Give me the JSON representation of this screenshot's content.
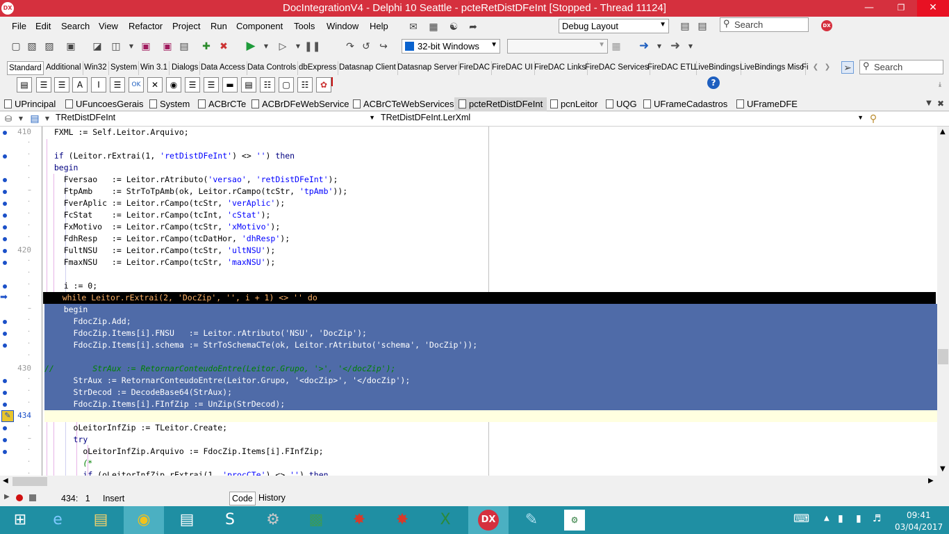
{
  "window": {
    "title": "DocIntegrationV4 - Delphi 10 Seattle - pcteRetDistDFeInt [Stopped - Thread 11124]",
    "app_icon": "DX"
  },
  "menu": [
    "File",
    "Edit",
    "Search",
    "View",
    "Refactor",
    "Project",
    "Run",
    "Component",
    "Tools",
    "Window",
    "Help"
  ],
  "layout_combo": "Debug Layout",
  "search_top": "Search",
  "platform_combo": "32-bit Windows",
  "palette_tabs": [
    "Standard",
    "Additional",
    "Win32",
    "System",
    "Win 3.1",
    "Dialogs",
    "Data Access",
    "Data Controls",
    "dbExpress",
    "Datasnap Client",
    "Datasnap Server",
    "FireDAC",
    "FireDAC UI",
    "FireDAC Links",
    "FireDAC Services",
    "FireDAC ETL",
    "LiveBindings",
    "LiveBindings Misc",
    "Fi"
  ],
  "palette_search": "Search",
  "file_tabs": [
    "UPrincipal",
    "UFuncoesGerais",
    "System",
    "ACBrCTe",
    "ACBrDFeWebService",
    "ACBrCTeWebServices",
    "pcteRetDistDFeInt",
    "pcnLeitor",
    "UQG",
    "UFrameCadastros",
    "UFrameDFE"
  ],
  "active_file_tab": "pcteRetDistDFeInt",
  "nav": {
    "class_combo": "TRetDistDFeInt",
    "method_combo": "TRetDistDFeInt.LerXml"
  },
  "code_lines": [
    {
      "num": "410",
      "dot": true,
      "text": "  FXML := Self.Leitor.Arquivo;"
    },
    {
      "num": "·",
      "dot": false,
      "text": ""
    },
    {
      "num": "·",
      "dot": true,
      "text": "  if (Leitor.rExtrai(1, 'retDistDFeInt') <> '') then"
    },
    {
      "num": "·",
      "dot": false,
      "text": "  begin"
    },
    {
      "num": "·",
      "dot": true,
      "text": "    Fversao   := Leitor.rAtributo('versao', 'retDistDFeInt');"
    },
    {
      "num": "–",
      "dot": true,
      "text": "    FtpAmb    := StrToTpAmb(ok, Leitor.rCampo(tcStr, 'tpAmb'));"
    },
    {
      "num": "·",
      "dot": true,
      "text": "    FverAplic := Leitor.rCampo(tcStr, 'verAplic');"
    },
    {
      "num": "·",
      "dot": true,
      "text": "    FcStat    := Leitor.rCampo(tcInt, 'cStat');"
    },
    {
      "num": "·",
      "dot": true,
      "text": "    FxMotivo  := Leitor.rCampo(tcStr, 'xMotivo');"
    },
    {
      "num": "·",
      "dot": true,
      "text": "    FdhResp   := Leitor.rCampo(tcDatHor, 'dhResp');"
    },
    {
      "num": "420",
      "dot": true,
      "text": "    FultNSU   := Leitor.rCampo(tcStr, 'ultNSU');"
    },
    {
      "num": "·",
      "dot": true,
      "text": "    FmaxNSU   := Leitor.rCampo(tcStr, 'maxNSU');"
    },
    {
      "num": "·",
      "dot": false,
      "text": ""
    },
    {
      "num": "·",
      "dot": true,
      "text": "    i := 0;"
    },
    {
      "num": "·",
      "dot": false,
      "text": "    while Leitor.rExtrai(2, 'DocZip', '', i + 1) <> '' do"
    },
    {
      "num": "–",
      "dot": false,
      "text": "    begin"
    },
    {
      "num": "·",
      "dot": true,
      "text": "      FdocZip.Add;"
    },
    {
      "num": "·",
      "dot": true,
      "text": "      FdocZip.Items[i].FNSU   := Leitor.rAtributo('NSU', 'DocZip');"
    },
    {
      "num": "·",
      "dot": true,
      "text": "      FdocZip.Items[i].schema := StrToSchemaCTe(ok, Leitor.rAtributo('schema', 'DocZip'));"
    },
    {
      "num": "·",
      "dot": false,
      "text": ""
    },
    {
      "num": "430",
      "dot": false,
      "text": "//        StrAux := RetornarConteudoEntre(Leitor.Grupo, '>', '</docZip');"
    },
    {
      "num": "·",
      "dot": true,
      "text": "      StrAux := RetornarConteudoEntre(Leitor.Grupo, '<docZip>', '</docZip');"
    },
    {
      "num": "·",
      "dot": true,
      "text": "      StrDecod := DecodeBase64(StrAux);"
    },
    {
      "num": "·",
      "dot": true,
      "text": "      FdocZip.Items[i].FInfZip := UnZip(StrDecod);"
    },
    {
      "num": "434",
      "dot": false,
      "text": ""
    },
    {
      "num": "·",
      "dot": true,
      "text": "      oLeitorInfZip := TLeitor.Create;"
    },
    {
      "num": "–",
      "dot": true,
      "text": "      try"
    },
    {
      "num": "·",
      "dot": true,
      "text": "        oLeitorInfZip.Arquivo := FdocZip.Items[i].FInfZip;"
    },
    {
      "num": "·",
      "dot": false,
      "text": "        (*"
    },
    {
      "num": "·",
      "dot": false,
      "text": "        if (oLeitorInfZip.rExtrai(1, 'procCTe') <> '') then"
    }
  ],
  "status": {
    "position": "434:   1",
    "mode": "Insert",
    "tab_code": "Code",
    "tab_history": "History"
  },
  "taskbar": {
    "apps": [
      "start-icon",
      "ie-icon",
      "explorer-icon",
      "chrome-icon",
      "rdp-icon",
      "skype-icon",
      "db-icon",
      "app-icon",
      "ruby-icon",
      "ruby2-icon",
      "excel-icon",
      "delphi-icon",
      "notepad-icon",
      "doc-icon"
    ],
    "time": "09:41",
    "date": "03/04/2017"
  },
  "colors": {
    "title_bar": "#d5303e",
    "selection": "#4f6ba8",
    "exec_line": "#000000",
    "taskbar": "#1f8fa3"
  }
}
